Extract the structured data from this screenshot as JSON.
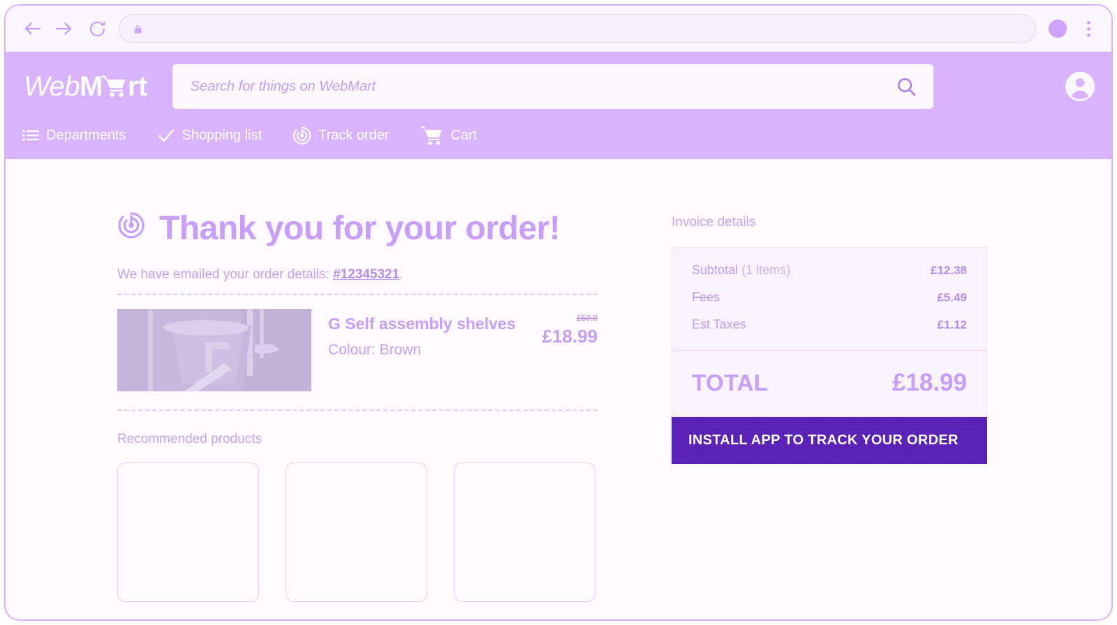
{
  "browser": {
    "back_icon": "back-arrow-icon",
    "forward_icon": "forward-arrow-icon",
    "reload_icon": "reload-icon",
    "lock_icon": "lock-icon",
    "url_value": "",
    "url_placeholder": "",
    "profile_icon": "profile-avatar-icon",
    "menu_icon": "kebab-menu-icon"
  },
  "header": {
    "logo": {
      "part1": "Web",
      "part2": "M",
      "cart_icon": "shopping-cart-icon",
      "part3": "rt"
    },
    "search": {
      "value": "",
      "placeholder": "Search for things on WebMart",
      "submit_icon": "search-icon"
    },
    "account_icon": "account-circle-icon",
    "nav": [
      {
        "label": "Departments",
        "icon": "list-menu-icon"
      },
      {
        "label": "Shopping list",
        "icon": "checkmark-icon"
      },
      {
        "label": "Track order",
        "icon": "radar-tracking-icon"
      },
      {
        "label": "Cart",
        "icon": "shopping-cart-icon"
      }
    ]
  },
  "main": {
    "heading": {
      "icon": "radar-tracking-icon",
      "text": "Thank you for your order!"
    },
    "emailed": {
      "prefix": "We have emailed your order details: ",
      "order_id": "#12345321",
      "suffix": "."
    },
    "product": {
      "image_alt": "self-assembly-shelves-photo",
      "title": "G Self assembly shelves",
      "variant_label": "Colour:",
      "variant_value": "Brown",
      "price_was": "£50.0",
      "price_now": "£18.99"
    },
    "recommended": {
      "title": "Recommended products",
      "cards": [
        "",
        "",
        ""
      ]
    }
  },
  "invoice": {
    "heading": "Invoice details",
    "lines": [
      {
        "label": "Subtotal",
        "count": "(1 items)",
        "value": "£12.38"
      },
      {
        "label": "Fees",
        "count": "",
        "value": "£5.49"
      },
      {
        "label": "Est Taxes",
        "count": "",
        "value": "£1.12"
      }
    ],
    "total_label": "TOTAL",
    "total_value": "£18.99",
    "cta_label": "INSTALL APP TO TRACK YOUR ORDER"
  },
  "colors": {
    "brand_purple": "#d9b3fd",
    "accent_light": "#c79ffb",
    "cta_purple": "#5b21b6",
    "page_bg": "#fdfbff",
    "panel_bg": "#f9f2ff"
  }
}
